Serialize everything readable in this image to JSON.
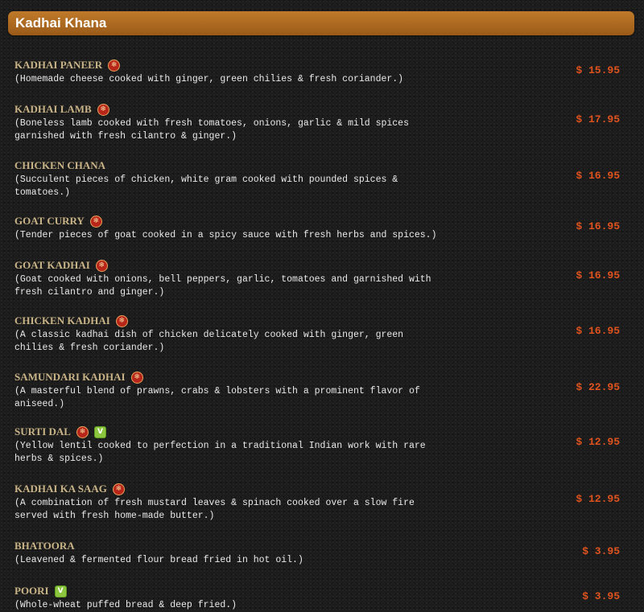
{
  "section": {
    "title": "Kadhai Khana"
  },
  "items": [
    {
      "name": "KADHAI PANEER",
      "desc": [
        "(Homemade cheese cooked with ginger, green chilies & fresh coriander.)"
      ],
      "price": "$ 15.95",
      "spicy": true,
      "veg": false
    },
    {
      "name": "KADHAI LAMB",
      "desc": [
        "(Boneless lamb cooked with fresh tomatoes, onions, garlic & mild spices",
        "garnished with fresh cilantro & ginger.)"
      ],
      "price": "$ 17.95",
      "spicy": true,
      "veg": false
    },
    {
      "name": "CHICKEN CHANA",
      "desc": [
        "(Succulent pieces of chicken, white gram cooked with pounded spices &",
        "tomatoes.)"
      ],
      "price": "$ 16.95",
      "spicy": false,
      "veg": false
    },
    {
      "name": "GOAT CURRY",
      "desc": [
        "(Tender pieces of goat cooked in a spicy sauce with fresh herbs and spices.)"
      ],
      "price": "$ 16.95",
      "spicy": true,
      "veg": false
    },
    {
      "name": "GOAT KADHAI",
      "desc": [
        "(Goat cooked with onions, bell peppers, garlic, tomatoes and garnished with",
        "fresh cilantro and ginger.)"
      ],
      "price": "$ 16.95",
      "spicy": true,
      "veg": false
    },
    {
      "name": "CHICKEN KADHAI",
      "desc": [
        "(A classic kadhai dish of chicken delicately cooked with ginger, green",
        "chilies & fresh coriander.)"
      ],
      "price": "$ 16.95",
      "spicy": true,
      "veg": false
    },
    {
      "name": "SAMUNDARI KADHAI",
      "desc": [
        "(A masterful blend of prawns, crabs & lobsters with a prominent flavor of",
        "aniseed.)"
      ],
      "price": "$ 22.95",
      "spicy": true,
      "veg": false
    },
    {
      "name": "SURTI DAL",
      "desc": [
        "(Yellow lentil cooked to perfection in a traditional Indian work with rare",
        "herbs & spices.)"
      ],
      "price": "$ 12.95",
      "spicy": true,
      "veg": true
    },
    {
      "name": "KADHAI KA SAAG",
      "desc": [
        "(A combination of fresh mustard leaves & spinach cooked over a slow fire",
        "served with fresh home-made butter.)"
      ],
      "price": "$ 12.95",
      "spicy": true,
      "veg": false
    },
    {
      "name": "BHATOORA",
      "desc": [
        "(Leavened & fermented flour bread fried in hot oil.)"
      ],
      "price": "$ 3.95",
      "spicy": false,
      "veg": false
    },
    {
      "name": "POORI",
      "desc": [
        "(Whole-wheat puffed bread & deep fried.)"
      ],
      "price": "$ 3.95",
      "spicy": false,
      "veg": true
    }
  ],
  "icons": {
    "spicy": "chili-pepper-icon",
    "veg": "vegetarian-leaf-icon"
  },
  "colors": {
    "header": "#b06e22",
    "name": "#c9b487",
    "price": "#e0531e",
    "spicy_badge": "#b8261a",
    "veg_badge": "#8cc63f"
  }
}
